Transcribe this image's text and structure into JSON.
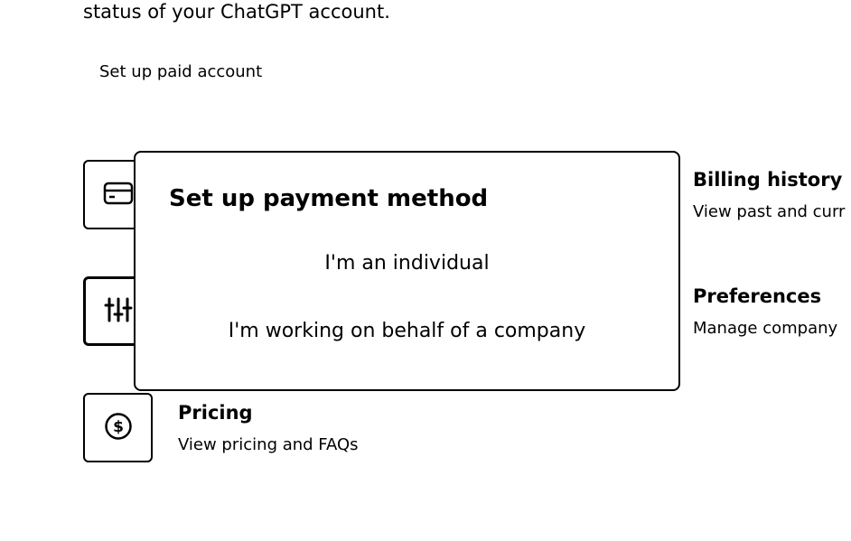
{
  "page": {
    "intro_text": "status of your ChatGPT account.",
    "setup_link": "Set up paid account"
  },
  "items": {
    "payment": {
      "icon": "credit-card-icon"
    },
    "limits": {
      "icon": "sliders-icon"
    },
    "billing": {
      "title": "Billing history",
      "description": "View past and curr"
    },
    "preferences": {
      "title": "Preferences",
      "description": "Manage company"
    },
    "pricing": {
      "icon": "dollar-circle-icon",
      "title": "Pricing",
      "description": "View pricing and FAQs"
    }
  },
  "modal": {
    "title": "Set up payment method",
    "options": [
      {
        "label": "I'm an individual"
      },
      {
        "label": "I'm working on behalf of a company"
      }
    ]
  }
}
